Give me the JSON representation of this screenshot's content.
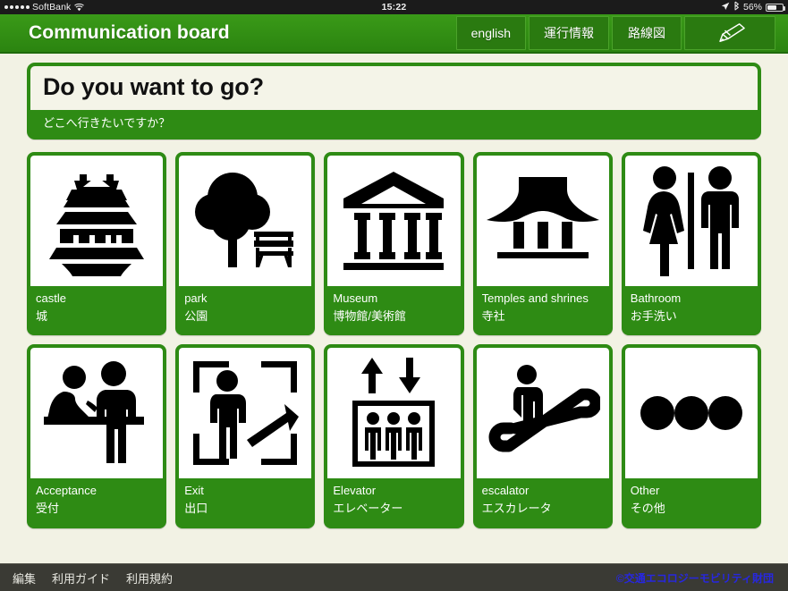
{
  "statusbar": {
    "carrier": "SoftBank",
    "wifi_icon": "wifi-icon",
    "signal_dots": 5,
    "time": "15:22",
    "location_icon": "location-arrow-icon",
    "bluetooth_icon": "bluetooth-icon",
    "battery": "56%"
  },
  "header": {
    "title": "Communication board",
    "nav": [
      {
        "label": "english",
        "name": "nav-button-english"
      },
      {
        "label": "運行情報",
        "name": "nav-button-service-info"
      },
      {
        "label": "路線図",
        "name": "nav-button-route-map"
      }
    ],
    "edit_icon": "pencil-icon"
  },
  "question": {
    "english": "Do you want to go?",
    "japanese": "どこへ行きたいですか？"
  },
  "cards": [
    {
      "en": "castle",
      "ja": "城",
      "icon": "castle-icon"
    },
    {
      "en": "park",
      "ja": "公園",
      "icon": "park-tree-bench-icon"
    },
    {
      "en": "Museum",
      "ja": "博物館/美術館",
      "icon": "museum-columns-icon"
    },
    {
      "en": "Temples and shrines",
      "ja": "寺社",
      "icon": "temple-shrine-icon"
    },
    {
      "en": "Bathroom",
      "ja": "お手洗い",
      "icon": "restroom-icon"
    },
    {
      "en": "Acceptance",
      "ja": "受付",
      "icon": "reception-counter-icon"
    },
    {
      "en": "Exit",
      "ja": "出口",
      "icon": "exit-icon"
    },
    {
      "en": "Elevator",
      "ja": "エレベーター",
      "icon": "elevator-icon"
    },
    {
      "en": "escalator",
      "ja": "エスカレータ",
      "icon": "escalator-icon"
    },
    {
      "en": "Other",
      "ja": "その他",
      "icon": "three-dots-icon"
    }
  ],
  "footer": {
    "links": [
      {
        "label": "編集",
        "name": "footer-link-edit"
      },
      {
        "label": "利用ガイド",
        "name": "footer-link-usage-guide"
      },
      {
        "label": "利用規約",
        "name": "footer-link-terms"
      }
    ],
    "copyright": "©交通エコロジーモビリティ財団"
  },
  "colors": {
    "brand_green": "#2e8b14",
    "button_green": "#2a7a10",
    "page_bg": "#f2f2e4",
    "footer_bg": "#3a3a34",
    "copyright_blue": "#2727e0"
  }
}
